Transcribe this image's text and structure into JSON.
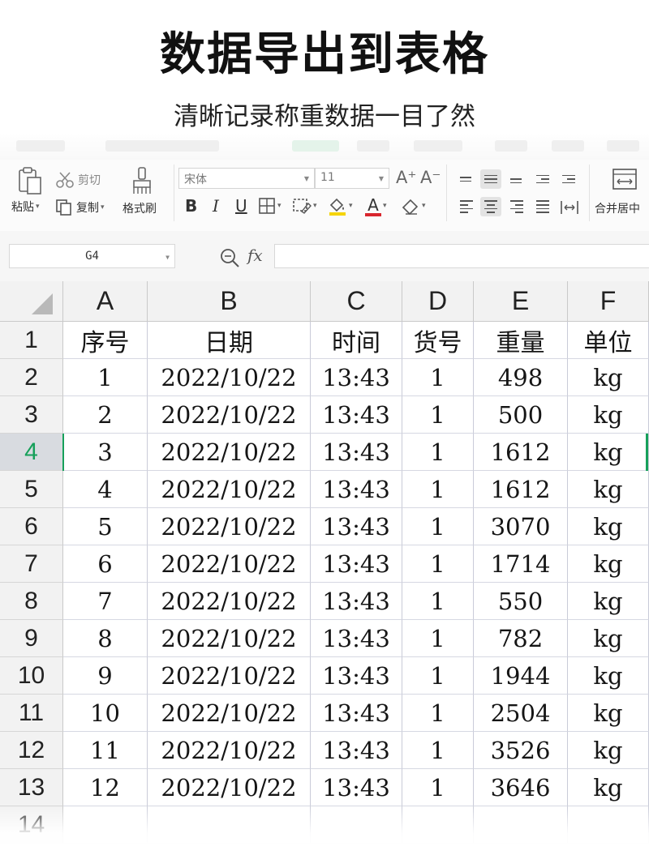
{
  "headline": "数据导出到表格",
  "subline": "清晰记录称重数据一目了然",
  "toolbar": {
    "paste": "粘贴",
    "cut": "剪切",
    "copy": "复制",
    "format_painter": "格式刷",
    "font_name": "宋体",
    "font_size": "11",
    "bold": "B",
    "italic": "I",
    "underline": "U",
    "grow_font": "A⁺",
    "shrink_font": "A⁻",
    "font_color": "A",
    "merge_center": "合并居中",
    "accent_color": "#16a05a",
    "font_color_bar": "#d9262e",
    "fill_color_bar": "#f5d400"
  },
  "formula_bar": {
    "cell_ref": "G4",
    "fx_label": "fx",
    "content": ""
  },
  "sheet": {
    "columns": [
      "A",
      "B",
      "C",
      "D",
      "E",
      "F"
    ],
    "row_numbers": [
      "1",
      "2",
      "3",
      "4",
      "5",
      "6",
      "7",
      "8",
      "9",
      "10",
      "11",
      "12",
      "13",
      "14"
    ],
    "selected_row": "4",
    "header_row": [
      "序号",
      "日期",
      "时间",
      "货号",
      "重量",
      "单位"
    ],
    "rows": [
      [
        "1",
        "2022/10/22",
        "13:43",
        "1",
        "498",
        "kg"
      ],
      [
        "2",
        "2022/10/22",
        "13:43",
        "1",
        "500",
        "kg"
      ],
      [
        "3",
        "2022/10/22",
        "13:43",
        "1",
        "1612",
        "kg"
      ],
      [
        "4",
        "2022/10/22",
        "13:43",
        "1",
        "1612",
        "kg"
      ],
      [
        "5",
        "2022/10/22",
        "13:43",
        "1",
        "3070",
        "kg"
      ],
      [
        "6",
        "2022/10/22",
        "13:43",
        "1",
        "1714",
        "kg"
      ],
      [
        "7",
        "2022/10/22",
        "13:43",
        "1",
        "550",
        "kg"
      ],
      [
        "8",
        "2022/10/22",
        "13:43",
        "1",
        "782",
        "kg"
      ],
      [
        "9",
        "2022/10/22",
        "13:43",
        "1",
        "1944",
        "kg"
      ],
      [
        "10",
        "2022/10/22",
        "13:43",
        "1",
        "2504",
        "kg"
      ],
      [
        "11",
        "2022/10/22",
        "13:43",
        "1",
        "3526",
        "kg"
      ],
      [
        "12",
        "2022/10/22",
        "13:43",
        "1",
        "3646",
        "kg"
      ]
    ]
  }
}
